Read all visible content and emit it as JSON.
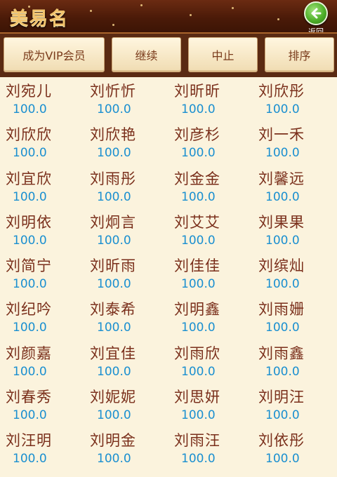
{
  "header": {
    "title": "美易名",
    "back_label": "返回",
    "back_icon": "back-arrow-icon"
  },
  "toolbar": {
    "vip_label": "成为VIP会员",
    "continue_label": "继续",
    "stop_label": "中止",
    "sort_label": "排序"
  },
  "names": [
    {
      "name": "刘宛儿",
      "score": "100.0"
    },
    {
      "name": "刘忻忻",
      "score": "100.0"
    },
    {
      "name": "刘昕昕",
      "score": "100.0"
    },
    {
      "name": "刘欣彤",
      "score": "100.0"
    },
    {
      "name": "刘欣欣",
      "score": "100.0"
    },
    {
      "name": "刘欣艳",
      "score": "100.0"
    },
    {
      "name": "刘彦杉",
      "score": "100.0"
    },
    {
      "name": "刘一禾",
      "score": "100.0"
    },
    {
      "name": "刘宜欣",
      "score": "100.0"
    },
    {
      "name": "刘雨彤",
      "score": "100.0"
    },
    {
      "name": "刘金金",
      "score": "100.0"
    },
    {
      "name": "刘馨远",
      "score": "100.0"
    },
    {
      "name": "刘明依",
      "score": "100.0"
    },
    {
      "name": "刘炯言",
      "score": "100.0"
    },
    {
      "name": "刘艾艾",
      "score": "100.0"
    },
    {
      "name": "刘果果",
      "score": "100.0"
    },
    {
      "name": "刘简宁",
      "score": "100.0"
    },
    {
      "name": "刘昕雨",
      "score": "100.0"
    },
    {
      "name": "刘佳佳",
      "score": "100.0"
    },
    {
      "name": "刘缤灿",
      "score": "100.0"
    },
    {
      "name": "刘纪吟",
      "score": "100.0"
    },
    {
      "name": "刘泰希",
      "score": "100.0"
    },
    {
      "name": "刘明鑫",
      "score": "100.0"
    },
    {
      "name": "刘雨姗",
      "score": "100.0"
    },
    {
      "name": "刘颜嘉",
      "score": "100.0"
    },
    {
      "name": "刘宜佳",
      "score": "100.0"
    },
    {
      "name": "刘雨欣",
      "score": "100.0"
    },
    {
      "name": "刘雨鑫",
      "score": "100.0"
    },
    {
      "name": "刘春秀",
      "score": "100.0"
    },
    {
      "name": "刘妮妮",
      "score": "100.0"
    },
    {
      "name": "刘思妍",
      "score": "100.0"
    },
    {
      "name": "刘明汪",
      "score": "100.0"
    },
    {
      "name": "刘汪明",
      "score": "100.0"
    },
    {
      "name": "刘明金",
      "score": "100.0"
    },
    {
      "name": "刘雨汪",
      "score": "100.0"
    },
    {
      "name": "刘依彤",
      "score": "100.0"
    }
  ],
  "colors": {
    "header_bg": "#4a1a08",
    "name_text": "#7a2f1b",
    "score_text": "#1a8fd0",
    "page_bg": "#fbf3dd",
    "back_green": "#4fb02a"
  }
}
